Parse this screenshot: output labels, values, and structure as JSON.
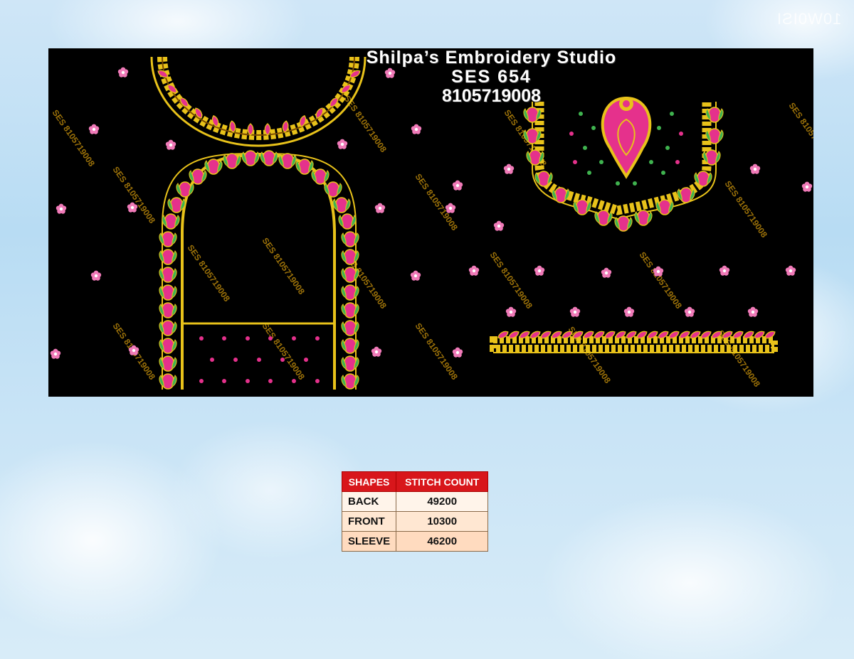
{
  "header": {
    "studio": "Shilpa’s Embroidery Studio",
    "code": "SES 654",
    "phone": "8105719008"
  },
  "watermark": "SES 8105719008",
  "corner_mark": "10W0ISI",
  "table": {
    "headers": [
      "SHAPES",
      "STITCH COUNT"
    ],
    "rows": [
      {
        "shape": "BACK",
        "count": "49200"
      },
      {
        "shape": "FRONT",
        "count": "10300"
      },
      {
        "shape": "SLEEVE",
        "count": "46200"
      }
    ]
  },
  "colors": {
    "background": "#000000",
    "gold": "#e8c21a",
    "pink": "#e5318c",
    "green": "#3fb34f",
    "header_red": "#d8161b"
  }
}
